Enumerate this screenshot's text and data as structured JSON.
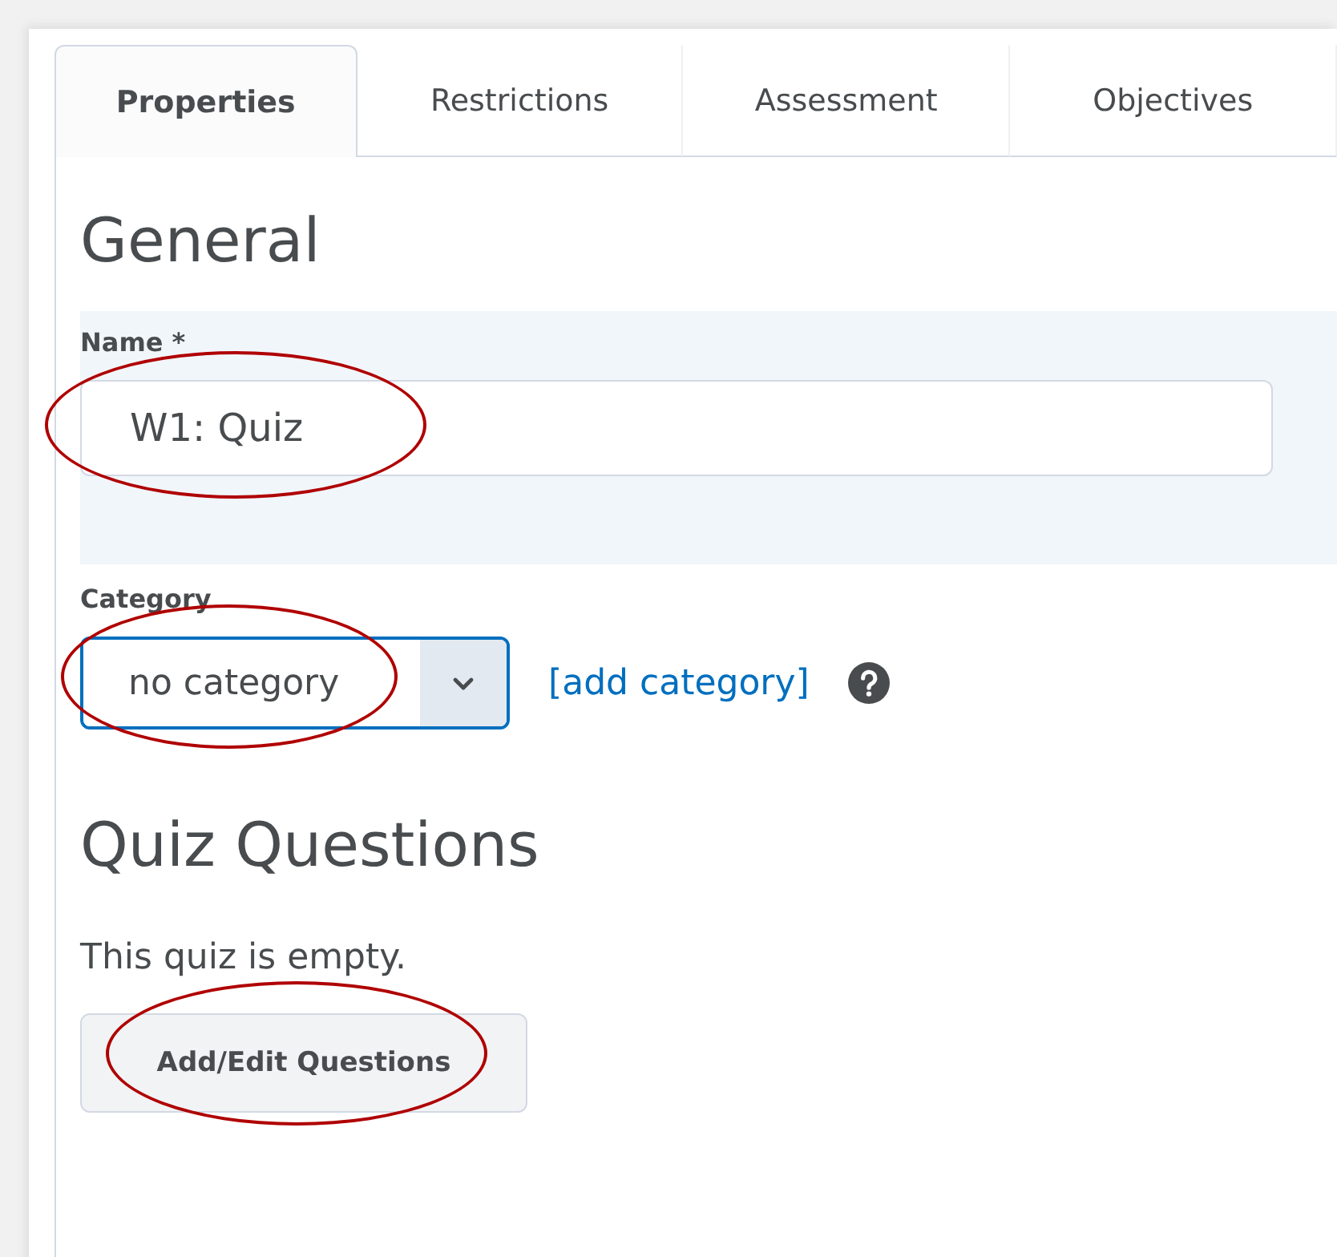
{
  "tabs": [
    {
      "label": "Properties",
      "selected": true
    },
    {
      "label": "Restrictions",
      "selected": false
    },
    {
      "label": "Assessment",
      "selected": false
    },
    {
      "label": "Objectives",
      "selected": false
    }
  ],
  "general": {
    "heading": "General",
    "name": {
      "label": "Name *",
      "value": "W1: Quiz",
      "circled": true
    },
    "category": {
      "label": "Category",
      "value": "no category",
      "circled": true,
      "link": "[add category]"
    }
  },
  "questions": {
    "heading": "Quiz Questions",
    "message": "This quiz is empty.",
    "button": {
      "label": "Add/Edit Questions",
      "circled": true
    }
  }
}
